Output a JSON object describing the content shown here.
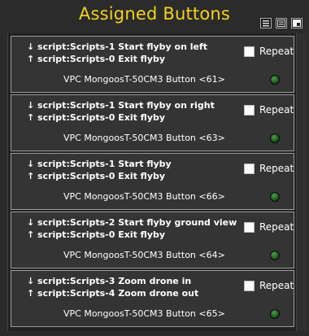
{
  "title": "Assigned Buttons",
  "repeat_label": "Repeat",
  "colors": {
    "title": "#f2d21e",
    "led": "#2e7d2e"
  },
  "toolbar_icons": [
    "list-view-icon",
    "detail-view-icon",
    "popout-icon"
  ],
  "entries": [
    {
      "line1": "↓ script:Scripts-1 Start flyby on left",
      "line2": "↑ script:Scripts-0 Exit flyby",
      "device": "VPC MongoosT-50CM3 Button <61>",
      "repeat": false
    },
    {
      "line1": "↓ script:Scripts-1 Start flyby on right",
      "line2": "↑ script:Scripts-0 Exit flyby",
      "device": "VPC MongoosT-50CM3 Button <63>",
      "repeat": false
    },
    {
      "line1": "↓ script:Scripts-1 Start flyby",
      "line2": "↑ script:Scripts-0 Exit flyby",
      "device": "VPC MongoosT-50CM3 Button <66>",
      "repeat": false
    },
    {
      "line1": "↓ script:Scripts-2 Start flyby ground view",
      "line2": "↑ script:Scripts-0 Exit flyby",
      "device": "VPC MongoosT-50CM3 Button <64>",
      "repeat": false
    },
    {
      "line1": "↓ script:Scripts-3 Zoom drone in",
      "line2": "↑ script:Scripts-4 Zoom drone out",
      "device": "VPC MongoosT-50CM3 Button <65>",
      "repeat": false
    }
  ]
}
